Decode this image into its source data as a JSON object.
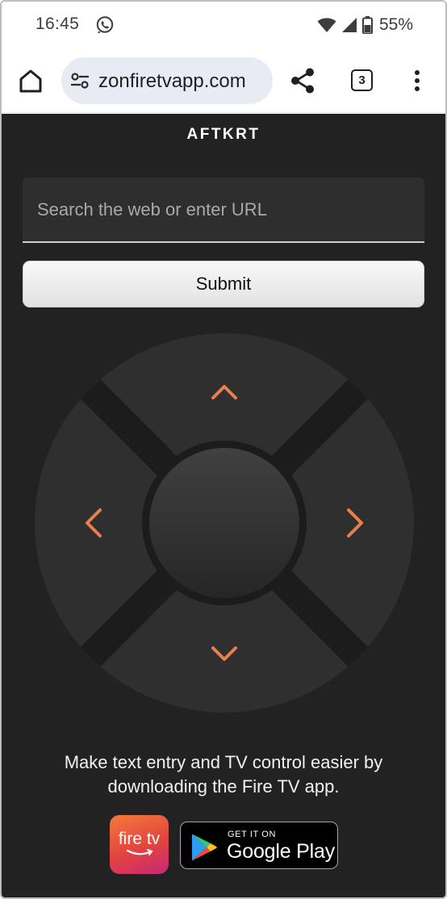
{
  "status_bar": {
    "time": "16:45",
    "battery": "55%",
    "icons": [
      "whatsapp-icon",
      "wifi-icon",
      "signal-icon",
      "battery-icon"
    ]
  },
  "browser": {
    "url": "zonfiretvapp.com",
    "tab_count": "3",
    "icons": [
      "home-icon",
      "tune-icon",
      "share-icon",
      "more-vert-icon"
    ]
  },
  "page": {
    "device_name": "AFTKRT",
    "search": {
      "placeholder": "Search the web or enter URL",
      "value": ""
    },
    "submit_label": "Submit",
    "dpad": {
      "buttons": [
        "up",
        "down",
        "left",
        "right",
        "select"
      ],
      "arrow_color": "#e8804e"
    },
    "promo_line1": "Make text entry and TV control easier by",
    "promo_line2": "downloading the Fire TV app.",
    "firetv_badge_text": "fire tv",
    "google_play": {
      "small": "GET IT ON",
      "big": "Google Play"
    }
  },
  "colors": {
    "page_bg": "#222222",
    "url_pill_bg": "#e8ebf3",
    "accent_orange": "#e8804e"
  }
}
